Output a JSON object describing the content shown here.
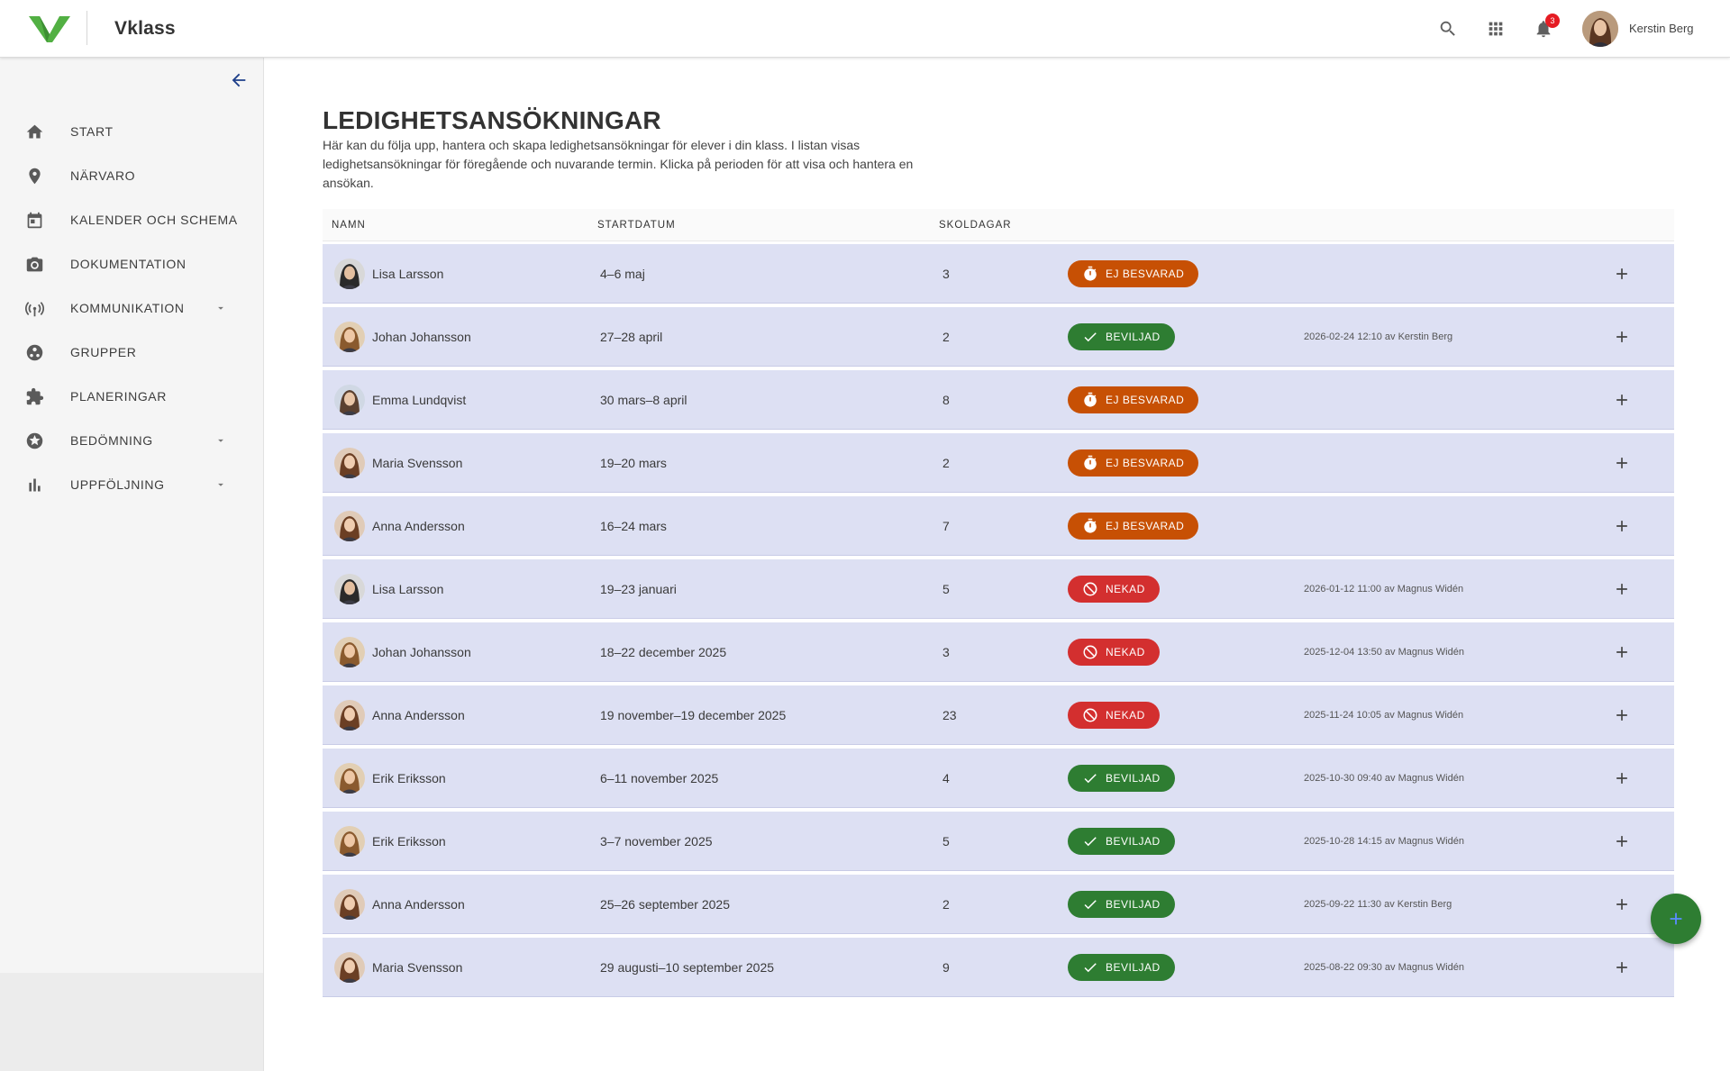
{
  "header": {
    "brand": "Vklass",
    "notification_count": "3",
    "user_name": "Kerstin Berg"
  },
  "sidebar": {
    "items": [
      {
        "label": "START",
        "icon": "home-icon"
      },
      {
        "label": "NÄRVARO",
        "icon": "location-pin-icon"
      },
      {
        "label": "KALENDER OCH SCHEMA",
        "icon": "calendar-icon"
      },
      {
        "label": "DOKUMENTATION",
        "icon": "camera-icon"
      },
      {
        "label": "KOMMUNIKATION",
        "icon": "broadcast-icon",
        "has_submenu": true
      },
      {
        "label": "GRUPPER",
        "icon": "groups-icon"
      },
      {
        "label": "PLANERINGAR",
        "icon": "puzzle-icon"
      },
      {
        "label": "BEDÖMNING",
        "icon": "star-badge-icon",
        "has_submenu": true
      },
      {
        "label": "UPPFÖLJNING",
        "icon": "bar-chart-icon",
        "has_submenu": true
      }
    ]
  },
  "main": {
    "title": "LEDIGHETSANSÖKNINGAR",
    "description": "Här kan du följa upp, hantera och skapa ledighetsansökningar för elever i din klass. I listan visas ledighetsansökningar för föregående och nuvarande termin. Klicka på perioden för att visa och hantera en ansökan.",
    "columns": {
      "name": "NAMN",
      "start": "STARTDATUM",
      "days": "SKOLDAGAR"
    },
    "rows": [
      {
        "name": "Lisa Larsson",
        "date": "4–6 maj",
        "days": "3",
        "status": "EJ BESVARAD",
        "status_type": "pending",
        "meta": ""
      },
      {
        "name": "Johan Johansson",
        "date": "27–28 april",
        "days": "2",
        "status": "BEVILJAD",
        "status_type": "approved",
        "meta": "2026-02-24 12:10 av Kerstin Berg"
      },
      {
        "name": "Emma Lundqvist",
        "date": "30 mars–8 april",
        "days": "8",
        "status": "EJ BESVARAD",
        "status_type": "pending",
        "meta": ""
      },
      {
        "name": "Maria Svensson",
        "date": "19–20 mars",
        "days": "2",
        "status": "EJ BESVARAD",
        "status_type": "pending",
        "meta": ""
      },
      {
        "name": "Anna Andersson",
        "date": "16–24 mars",
        "days": "7",
        "status": "EJ BESVARAD",
        "status_type": "pending",
        "meta": ""
      },
      {
        "name": "Lisa Larsson",
        "date": "19–23 januari",
        "days": "5",
        "status": "NEKAD",
        "status_type": "denied",
        "meta": "2026-01-12 11:00 av Magnus Widén"
      },
      {
        "name": "Johan Johansson",
        "date": "18–22 december 2025",
        "days": "3",
        "status": "NEKAD",
        "status_type": "denied",
        "meta": "2025-12-04 13:50 av Magnus Widén"
      },
      {
        "name": "Anna Andersson",
        "date": "19 november–19 december 2025",
        "days": "23",
        "status": "NEKAD",
        "status_type": "denied",
        "meta": "2025-11-24 10:05 av Magnus Widén"
      },
      {
        "name": "Erik Eriksson",
        "date": "6–11 november 2025",
        "days": "4",
        "status": "BEVILJAD",
        "status_type": "approved",
        "meta": "2025-10-30 09:40 av Magnus Widén"
      },
      {
        "name": "Erik Eriksson",
        "date": "3–7 november 2025",
        "days": "5",
        "status": "BEVILJAD",
        "status_type": "approved",
        "meta": "2025-10-28 14:15 av Magnus Widén"
      },
      {
        "name": "Anna Andersson",
        "date": "25–26 september 2025",
        "days": "2",
        "status": "BEVILJAD",
        "status_type": "approved",
        "meta": "2025-09-22 11:30 av Kerstin Berg"
      },
      {
        "name": "Maria Svensson",
        "date": "29 augusti–10 september 2025",
        "days": "9",
        "status": "BEVILJAD",
        "status_type": "approved",
        "meta": "2025-08-22 09:30 av Magnus Widén"
      }
    ]
  },
  "colors": {
    "brand_green": "#4caf50",
    "row_bg": "#dde0f3",
    "pending": "#c75004",
    "approved": "#2e7d32",
    "denied": "#d32f2f",
    "fab": "#2e7d32"
  }
}
